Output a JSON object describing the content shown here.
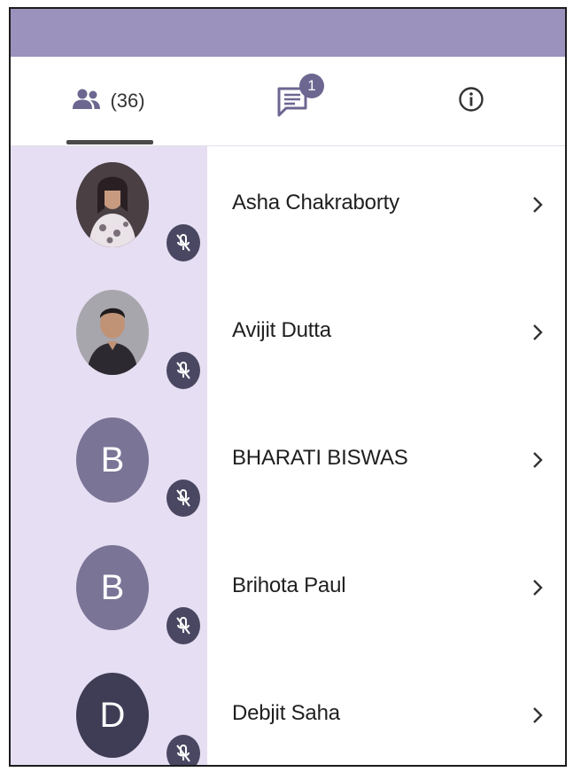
{
  "tabs": {
    "people_count": "(36)",
    "chat_badge": "1"
  },
  "participants": [
    {
      "name": "Asha Chakraborty",
      "initial": "",
      "avatar": "photo-woman",
      "mic": "muted"
    },
    {
      "name": "Avijit Dutta",
      "initial": "",
      "avatar": "photo-man",
      "mic": "muted"
    },
    {
      "name": "BHARATI BISWAS",
      "initial": "B",
      "avatar": "initial",
      "mic": "muted"
    },
    {
      "name": "Brihota Paul",
      "initial": "B",
      "avatar": "initial",
      "mic": "muted"
    },
    {
      "name": "Debjit Saha",
      "initial": "D",
      "avatar": "initial",
      "mic": "muted"
    }
  ],
  "colors": {
    "header": "#9b92bd",
    "list_highlight": "#e6def2",
    "avatar_b": "#7a7496",
    "avatar_d": "#3f3c56",
    "mute_badge": "#4a4763",
    "accent_icon": "#6c6791"
  },
  "icons": {
    "people_tab": "people-icon",
    "chat_tab": "chat-icon",
    "info_tab": "info-icon",
    "row_mic": "mic-off-icon",
    "row_chevron": "chevron-right-icon"
  }
}
